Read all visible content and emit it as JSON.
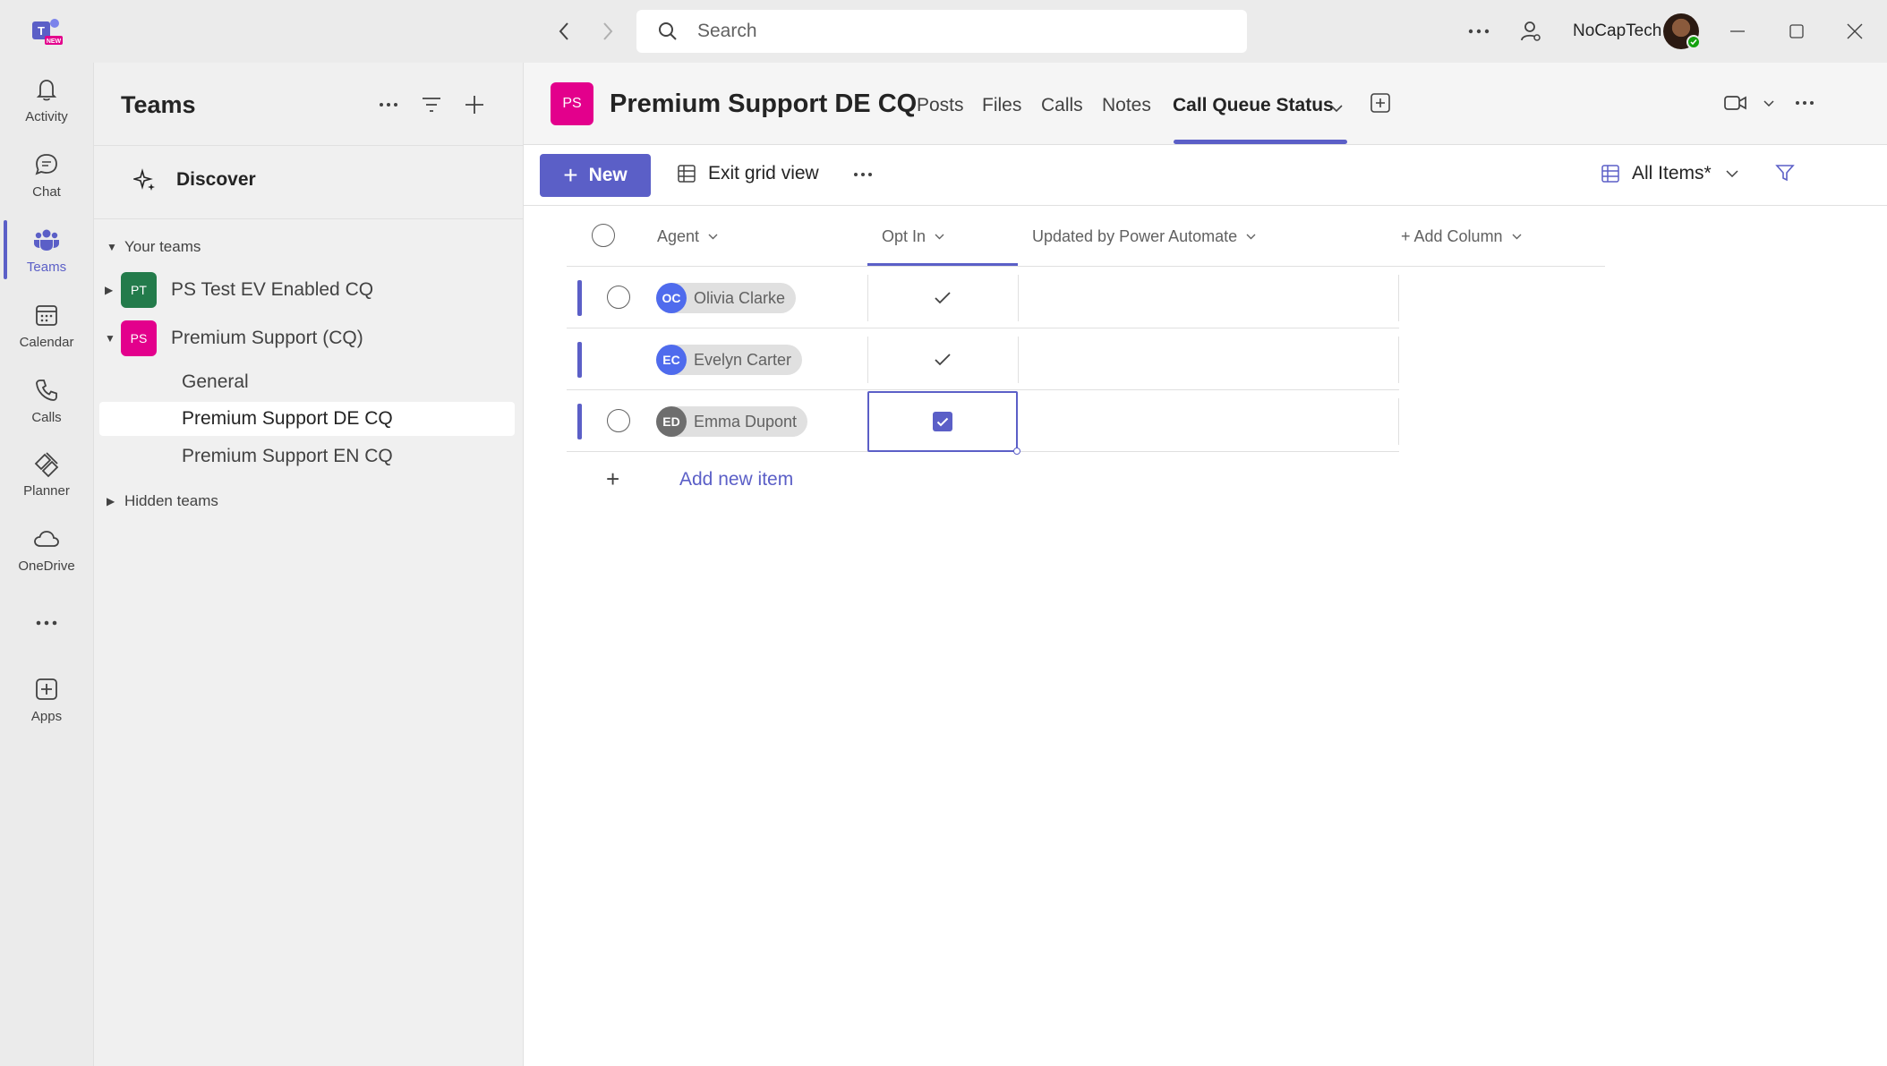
{
  "titlebar": {
    "search_placeholder": "Search",
    "org_name": "NoCapTech",
    "logo_badge": "NEW"
  },
  "rail": {
    "items": [
      {
        "label": "Activity",
        "icon": "bell-icon"
      },
      {
        "label": "Chat",
        "icon": "chat-icon"
      },
      {
        "label": "Teams",
        "icon": "teams-icon",
        "active": true
      },
      {
        "label": "Calendar",
        "icon": "calendar-icon"
      },
      {
        "label": "Calls",
        "icon": "phone-icon"
      },
      {
        "label": "Planner",
        "icon": "planner-icon"
      },
      {
        "label": "OneDrive",
        "icon": "cloud-icon"
      },
      {
        "label": "Apps",
        "icon": "add-app-icon"
      }
    ]
  },
  "teams_panel": {
    "title": "Teams",
    "discover": "Discover",
    "your_teams": "Your teams",
    "teams": [
      {
        "initials": "PT",
        "name": "PS Test EV Enabled CQ",
        "color": "#237b4b",
        "expanded": false
      },
      {
        "initials": "PS",
        "name": "Premium Support (CQ)",
        "color": "#e3008c",
        "expanded": true,
        "channels": [
          "General",
          "Premium Support DE CQ",
          "Premium Support EN CQ"
        ]
      }
    ],
    "hidden_teams": "Hidden teams"
  },
  "channel": {
    "badge": "PS",
    "title": "Premium Support DE CQ",
    "tabs": [
      "Posts",
      "Files",
      "Calls",
      "Notes",
      "Call Queue Status"
    ],
    "active_tab": "Call Queue Status"
  },
  "toolbar": {
    "new_label": "New",
    "exit_grid_label": "Exit grid view",
    "view_label": "All Items*"
  },
  "grid": {
    "columns": [
      "Agent",
      "Opt In",
      "Updated by Power Automate",
      "+ Add Column"
    ],
    "rows": [
      {
        "initials": "OC",
        "name": "Olivia Clarke",
        "avatar_color": "#4f6bed",
        "opt_in": true
      },
      {
        "initials": "EC",
        "name": "Evelyn Carter",
        "avatar_color": "#4f6bed",
        "opt_in": true
      },
      {
        "initials": "ED",
        "name": "Emma Dupont",
        "avatar_color": "#6e6e6e",
        "opt_in": true,
        "editing": true
      }
    ],
    "add_item_label": "Add new item"
  },
  "colors": {
    "accent": "#5b5fc7",
    "team_ps": "#e3008c",
    "team_pt": "#237b4b"
  }
}
